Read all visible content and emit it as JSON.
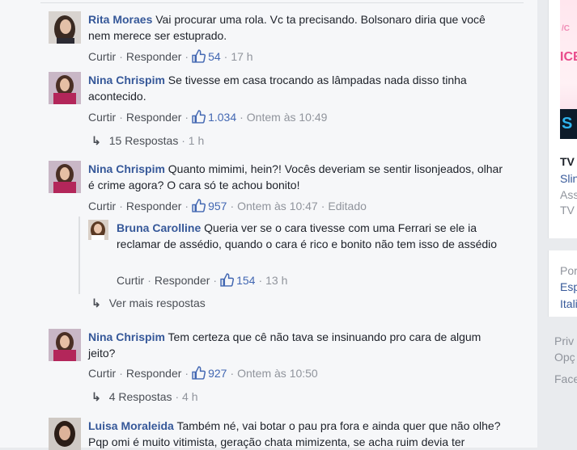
{
  "action_labels": {
    "like": "Curtir",
    "reply": "Responder",
    "dot": "·"
  },
  "comments": [
    {
      "author": "Rita Moraes",
      "text": "Vai procurar uma rola. Vc ta precisando. Bolsonaro diria que você nem merece ser estuprado.",
      "likes": "54",
      "time": "17 h"
    },
    {
      "author": "Nina Chrispim",
      "text": "Se tivesse em casa trocando as lâmpadas nada disso tinha acontecido.",
      "likes": "1.034",
      "time": "Ontem às 10:49",
      "replies_label": "15 Respostas",
      "replies_time": "1 h"
    },
    {
      "author": "Nina Chrispim",
      "text": "Quanto mimimi, hein?! Vocês deveriam se sentir lisonjeados, olhar é crime agora? O cara só te achou bonito!",
      "likes": "957",
      "time": "Ontem às 10:47",
      "edited": "Editado",
      "reply": {
        "author": "Bruna Carolline",
        "text": "Queria ver se o cara tivesse com uma Ferrari se ele ia reclamar de assédio, quando o cara é rico e bonito não tem isso de assédio",
        "likes": "154",
        "time": "13 h"
      },
      "more_replies": "Ver mais respostas"
    },
    {
      "author": "Nina Chrispim",
      "text": "Tem certeza que cê não tava se insinuando pro cara de algum jeito?",
      "likes": "927",
      "time": "Ontem às 10:50",
      "replies_label": "4 Respostas",
      "replies_time": "4 h"
    },
    {
      "author": "Luisa Moraleida",
      "text": "Também né, vai botar o pau pra fora e ainda quer que não olhe? Pqp omi é muito vitimista, geração chata mimizenta, se acha ruim devia ter"
    }
  ],
  "sidebar": {
    "promo_text_1": "/C",
    "promo_text_2": "ICE",
    "promo_dark_text": "S",
    "title": "TV",
    "lines": [
      "Slin",
      "Ass",
      "TV"
    ],
    "card2_lines": [
      "Por",
      "Esp",
      "Itali"
    ],
    "footer_lines": [
      "Priv",
      "Opç",
      "Face"
    ]
  },
  "colors": {
    "link": "#365899",
    "like": "#4267b2",
    "muted": "#90949c",
    "bg": "#f6f7f9"
  },
  "icons": [
    "thumbs-up-icon",
    "reply-arrow-icon",
    "avatar"
  ]
}
